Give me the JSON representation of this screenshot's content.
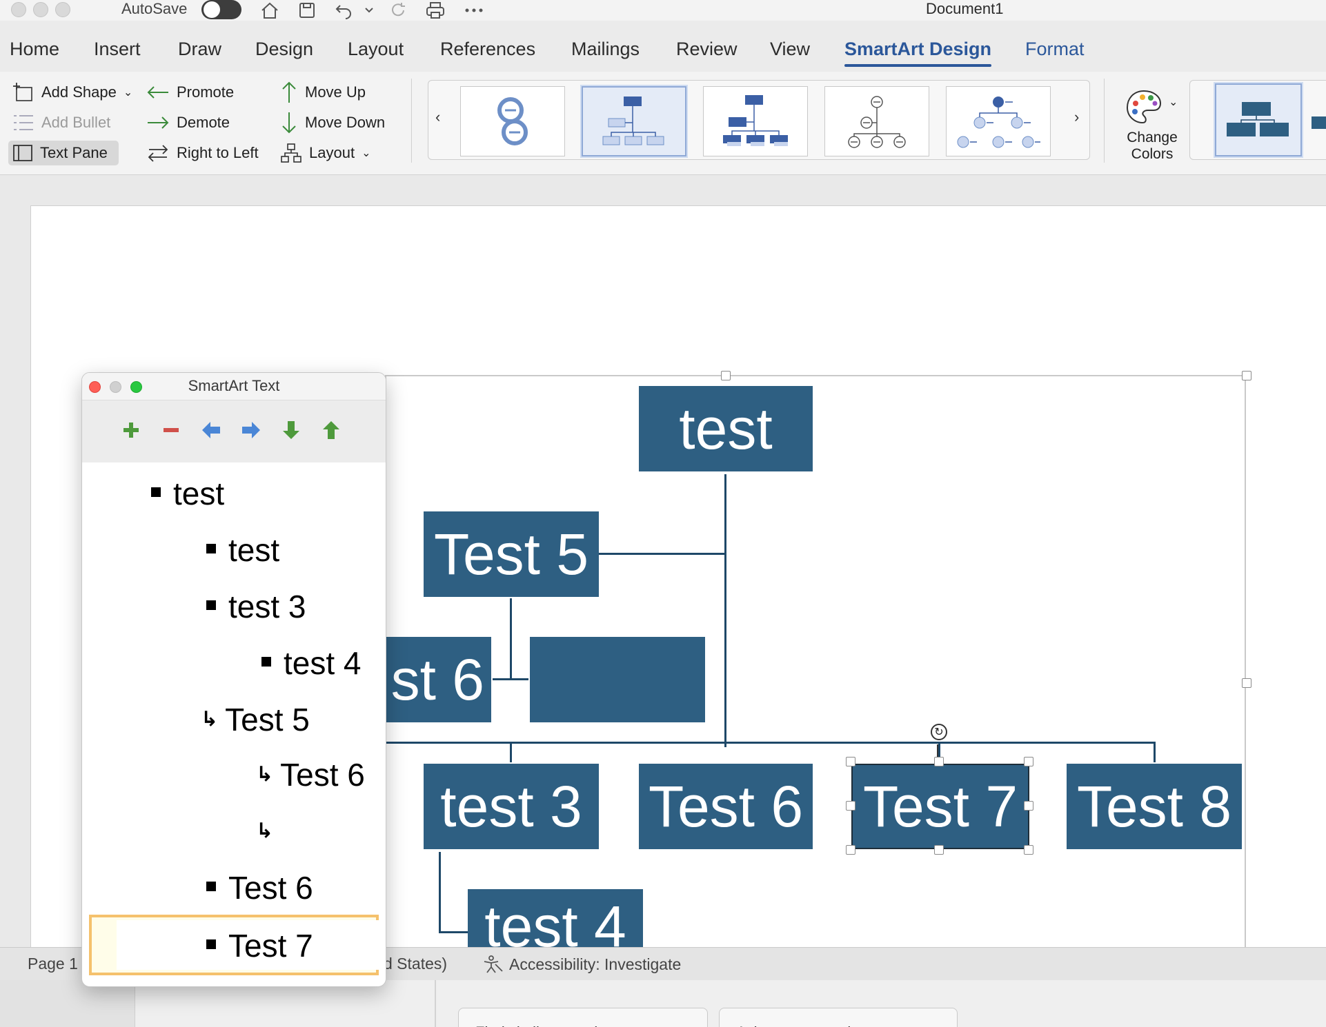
{
  "titlebar": {
    "autosave_label": "AutoSave",
    "document_title": "Document1"
  },
  "tabs": [
    {
      "label": "Home"
    },
    {
      "label": "Insert"
    },
    {
      "label": "Draw"
    },
    {
      "label": "Design"
    },
    {
      "label": "Layout"
    },
    {
      "label": "References"
    },
    {
      "label": "Mailings"
    },
    {
      "label": "Review"
    },
    {
      "label": "View"
    },
    {
      "label": "SmartArt Design"
    },
    {
      "label": "Format"
    }
  ],
  "ribbon": {
    "add_shape": "Add Shape",
    "add_bullet": "Add Bullet",
    "text_pane": "Text Pane",
    "promote": "Promote",
    "demote": "Demote",
    "right_to_left": "Right to Left",
    "move_up": "Move Up",
    "move_down": "Move Down",
    "layout": "Layout",
    "change_colors_line1": "Change",
    "change_colors_line2": "Colors"
  },
  "colors": {
    "node_fill": "#2e5f82",
    "connector": "#1e4868",
    "accent": "#2b579a"
  },
  "smartart": {
    "n_top": "test",
    "n_test5": "Test 5",
    "n_test6_left": "st 6",
    "n_test3": "test 3",
    "n_test6": "Test 6",
    "n_test7": "Test 7",
    "n_test8": "Test 8",
    "n_test4": "test 4"
  },
  "text_pane": {
    "title": "SmartArt Text",
    "items": [
      {
        "text": "test"
      },
      {
        "text": "test"
      },
      {
        "text": "test 3"
      },
      {
        "text": "test 4"
      },
      {
        "text": "Test 5"
      },
      {
        "text": "Test 6"
      },
      {
        "text": ""
      },
      {
        "text": "Test 6"
      },
      {
        "text": "Test 7"
      }
    ]
  },
  "statusbar": {
    "page": "Page 1",
    "language_fragment": "d States)",
    "accessibility": "Accessibility: Investigate"
  },
  "lower": {
    "btn1": "Find similar questions",
    "btn2": "Ask a new question"
  }
}
